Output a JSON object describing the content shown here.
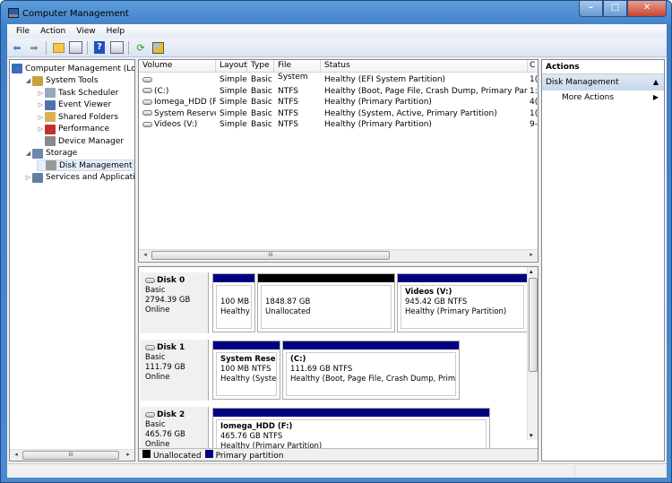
{
  "window": {
    "title": "Computer Management",
    "controls": {
      "minimize": "–",
      "maximize": "□",
      "close": "✕"
    }
  },
  "menu": [
    "File",
    "Action",
    "View",
    "Help"
  ],
  "toolbar": [
    "back-icon",
    "forward-icon",
    "up-folder-icon",
    "show-hide-tree-icon",
    "help-icon",
    "show-hide-action-pane-icon",
    "refresh-icon",
    "properties-icon"
  ],
  "tree": [
    {
      "label": "Computer Management (Local",
      "level": 0,
      "expander": "",
      "icon": "computer-management-icon"
    },
    {
      "label": "System Tools",
      "level": 1,
      "expander": "◢",
      "icon": "system-tools-icon"
    },
    {
      "label": "Task Scheduler",
      "level": 2,
      "expander": "▷",
      "icon": "task-scheduler-icon"
    },
    {
      "label": "Event Viewer",
      "level": 2,
      "expander": "▷",
      "icon": "event-viewer-icon"
    },
    {
      "label": "Shared Folders",
      "level": 2,
      "expander": "▷",
      "icon": "shared-folders-icon"
    },
    {
      "label": "Performance",
      "level": 2,
      "expander": "▷",
      "icon": "performance-icon"
    },
    {
      "label": "Device Manager",
      "level": 2,
      "expander": "",
      "icon": "device-manager-icon"
    },
    {
      "label": "Storage",
      "level": 1,
      "expander": "◢",
      "icon": "storage-icon"
    },
    {
      "label": "Disk Management",
      "level": 2,
      "expander": "",
      "icon": "disk-management-icon",
      "selected": true
    },
    {
      "label": "Services and Applications",
      "level": 1,
      "expander": "▷",
      "icon": "services-icon"
    }
  ],
  "volume_list": {
    "columns": [
      "Volume",
      "Layout",
      "Type",
      "File System",
      "Status",
      "C"
    ],
    "rows": [
      {
        "volume": "",
        "layout": "Simple",
        "type": "Basic",
        "fs": "",
        "status": "Healthy (EFI System Partition)",
        "capacity": "1("
      },
      {
        "volume": "(C:)",
        "layout": "Simple",
        "type": "Basic",
        "fs": "NTFS",
        "status": "Healthy (Boot, Page File, Crash Dump, Primary Partition)",
        "capacity": "1:"
      },
      {
        "volume": "Iomega_HDD (F:)",
        "layout": "Simple",
        "type": "Basic",
        "fs": "NTFS",
        "status": "Healthy (Primary Partition)",
        "capacity": "4("
      },
      {
        "volume": "System Reserved",
        "layout": "Simple",
        "type": "Basic",
        "fs": "NTFS",
        "status": "Healthy (System, Active, Primary Partition)",
        "capacity": "1("
      },
      {
        "volume": "Videos (V:)",
        "layout": "Simple",
        "type": "Basic",
        "fs": "NTFS",
        "status": "Healthy (Primary Partition)",
        "capacity": "9-"
      }
    ]
  },
  "disks": [
    {
      "name": "Disk 0",
      "type": "Basic",
      "size": "2794.39 GB",
      "state": "Online",
      "partitions": [
        {
          "title": "",
          "line1": "100 MB",
          "line2": "Healthy (I",
          "kind": "primary"
        },
        {
          "title": "",
          "line1": "1848.87 GB",
          "line2": "Unallocated",
          "kind": "unallocated"
        },
        {
          "title": "Videos  (V:)",
          "line1": "945.42 GB NTFS",
          "line2": "Healthy (Primary Partition)",
          "kind": "primary"
        }
      ]
    },
    {
      "name": "Disk 1",
      "type": "Basic",
      "size": "111.79 GB",
      "state": "Online",
      "partitions": [
        {
          "title": "System Reserve",
          "line1": "100 MB NTFS",
          "line2": "Healthy (System,",
          "kind": "primary"
        },
        {
          "title": "(C:)",
          "line1": "111.69 GB NTFS",
          "line2": "Healthy (Boot, Page File, Crash Dump, Primary",
          "kind": "primary"
        }
      ]
    },
    {
      "name": "Disk 2",
      "type": "Basic",
      "size": "465.76 GB",
      "state": "Online",
      "partitions": [
        {
          "title": "Iomega_HDD  (F:)",
          "line1": "465.76 GB NTFS",
          "line2": "Healthy (Primary Partition)",
          "kind": "primary"
        }
      ]
    }
  ],
  "legend": [
    {
      "label": "Unallocated",
      "color": "#000000"
    },
    {
      "label": "Primary partition",
      "color": "#000080"
    }
  ],
  "actions": {
    "header": "Actions",
    "section": "Disk Management",
    "items": [
      "More Actions"
    ]
  },
  "colors": {
    "primary": "#000080",
    "unallocated": "#000000"
  }
}
